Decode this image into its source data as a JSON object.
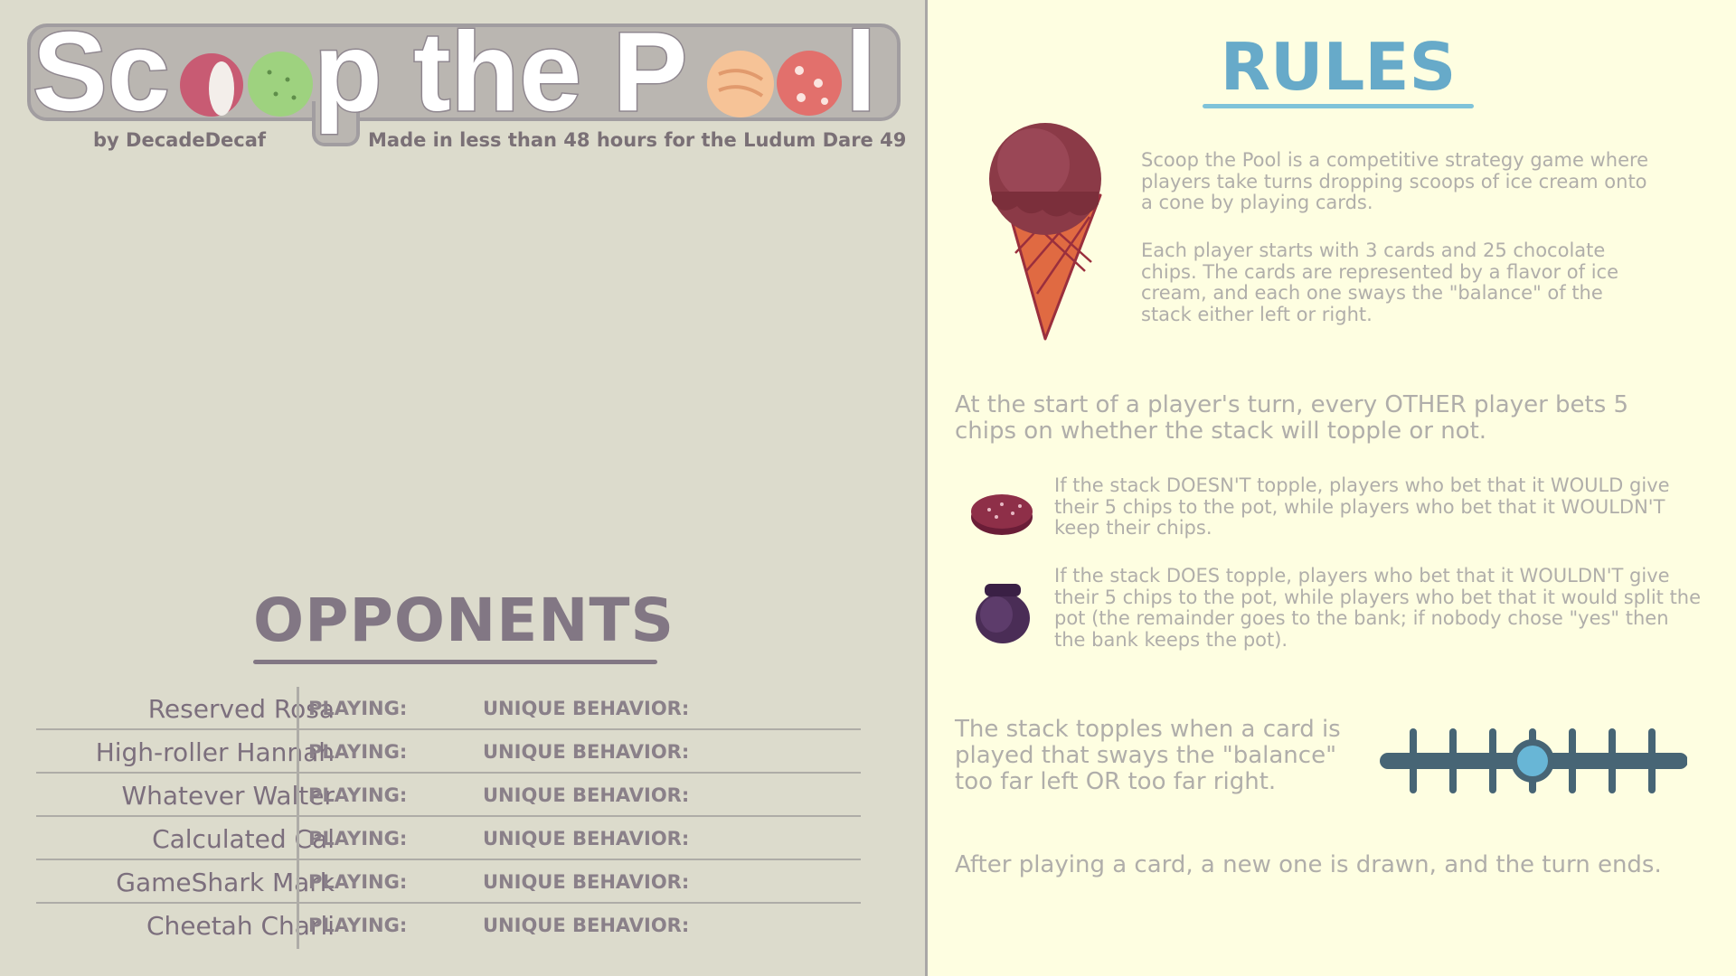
{
  "game": {
    "title": "Scoop the Pool",
    "author": "by DecadeDecaf",
    "credit": "Made in less than 48 hours for the Ludum Dare 49"
  },
  "opponents": {
    "heading": "OPPONENTS",
    "playing_label": "PLAYING:",
    "unique_label": "UNIQUE BEHAVIOR:",
    "list": [
      {
        "name": "Reserved Rosa"
      },
      {
        "name": "High-roller Hannah"
      },
      {
        "name": "Whatever Walter"
      },
      {
        "name": "Calculated Cal"
      },
      {
        "name": "GameShark Mark"
      },
      {
        "name": "Cheetah Charli"
      }
    ]
  },
  "rules": {
    "heading": "RULES",
    "intro_1": "Scoop the Pool is a competitive strategy game where players take turns dropping scoops of ice cream onto a cone by playing cards.",
    "intro_2": "Each player starts with 3 cards and 25 chocolate chips. The cards are represented by a flavor of ice cream, and each one sways the \"balance\" of the stack either left or right.",
    "betting": "At the start of a player's turn, every OTHER player bets 5 chips on whether the stack will topple or not.",
    "no_topple": "If the stack DOESN'T topple, players who bet that it WOULD give their 5 chips to the pot, while players who bet that it WOULDN'T keep their chips.",
    "topple": "If the stack DOES topple, players who bet that it WOULDN'T give their 5 chips to the pot, while players who bet that it would split the pot (the remainder goes to the bank; if nobody chose \"yes\" then the bank keeps the pot).",
    "balance": "The stack topples when a card is played that sways the \"balance\" too far left OR too far right.",
    "end_turn": "After playing a card, a new one is drawn, and the turn ends."
  },
  "icons": [
    "ice-cream-cone-icon",
    "chip-icon",
    "pot-icon",
    "balance-meter-icon"
  ],
  "colors": {
    "accent_blue": "#67aac9",
    "opponent_purple": "#827784",
    "left_bg": "#dcdbcc",
    "right_bg": "#fefee1"
  }
}
